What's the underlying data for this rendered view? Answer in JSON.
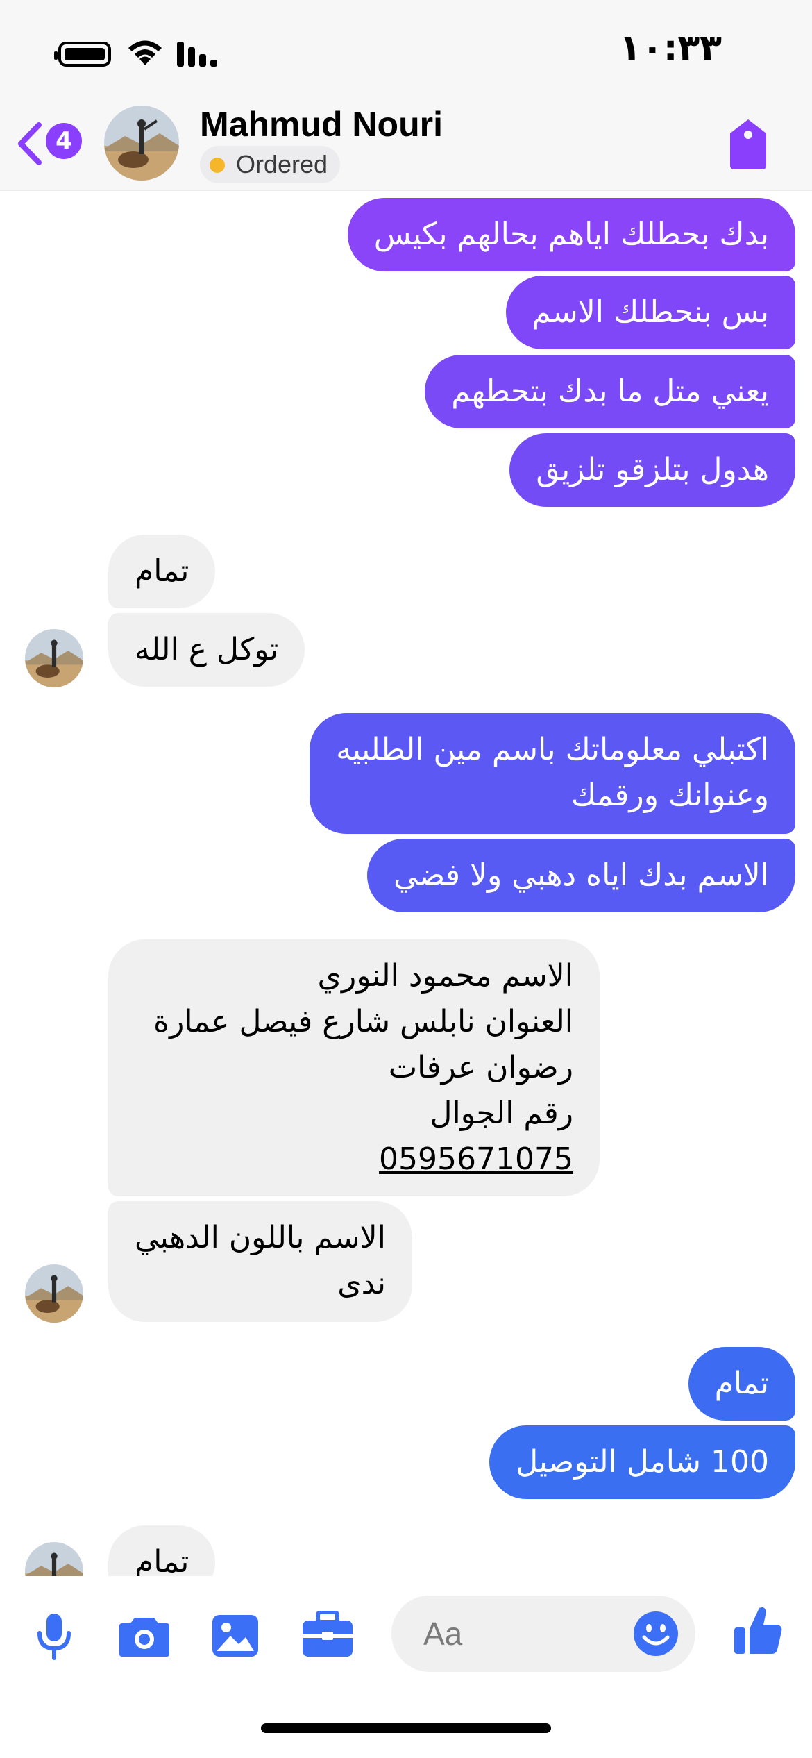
{
  "status_bar": {
    "time": "١٠:٣٣"
  },
  "header": {
    "back_count": "4",
    "name": "Mahmud Nouri",
    "status": "Ordered",
    "status_color": "#f5b62a",
    "accent": "#8a3ffc"
  },
  "messages": [
    {
      "dir": "out",
      "text": "بدك بحطلك اياهم بحالهم بكيس",
      "color": "#8a45f9"
    },
    {
      "dir": "out",
      "text": "بس بنحطلك الاسم",
      "color": "#8047f8"
    },
    {
      "dir": "out",
      "text": "يعني متل ما بدك بتحطهم",
      "color": "#7b4af7"
    },
    {
      "dir": "out",
      "text": "هدول بتلزقو تلزيق",
      "color": "#744cf6"
    },
    {
      "dir": "in",
      "text": "تمام"
    },
    {
      "dir": "in",
      "text": "توكل ع الله"
    },
    {
      "dir": "out",
      "lines": [
        "اكتبلي معلوماتك باسم مين الطلبيه",
        "وعنوانك ورقمك"
      ],
      "color": "#5c58f4"
    },
    {
      "dir": "out",
      "text": "الاسم بدك اياه دهبي ولا فضي",
      "color": "#575bf4"
    },
    {
      "dir": "in",
      "lines": [
        "الاسم محمود النوري",
        "العنوان نابلس شارع فيصل عمارة",
        "رضوان عرفات",
        "رقم الجوال"
      ],
      "phone": "0595671075"
    },
    {
      "dir": "in",
      "lines": [
        "الاسم باللون الدهبي",
        "ندى"
      ]
    },
    {
      "dir": "out",
      "text": "تمام",
      "color": "#3d6cf2"
    },
    {
      "dir": "out",
      "text": "100 شامل التوصيل",
      "color": "#3a6ff2"
    },
    {
      "dir": "in",
      "text": "تمام"
    }
  ],
  "composer": {
    "placeholder": "Aa"
  },
  "bottom_icons": [
    "microphone-icon",
    "camera-icon",
    "gallery-icon",
    "toolbox-icon",
    "emoji-icon",
    "thumbs-up-icon"
  ],
  "icon_color": "#3b6ff5"
}
